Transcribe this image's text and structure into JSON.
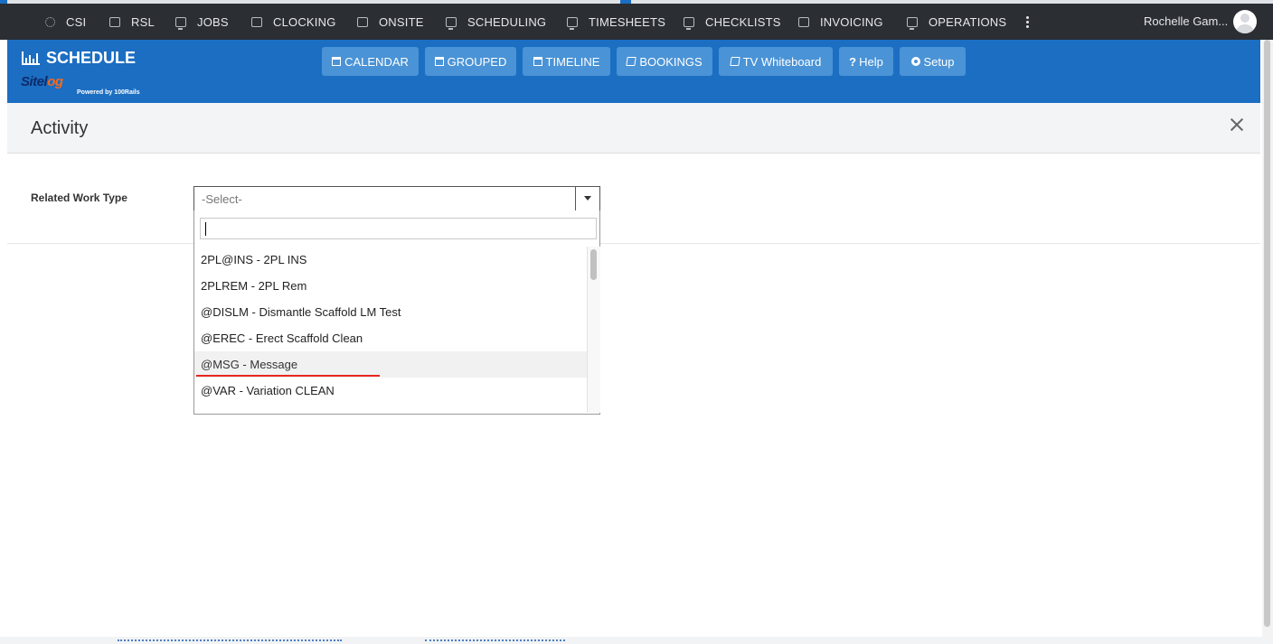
{
  "topnav": {
    "items": [
      {
        "label": "CSI",
        "icon": "gear-icon"
      },
      {
        "label": "RSL",
        "icon": "screen-icon"
      },
      {
        "label": "JOBS",
        "icon": "monitor-icon"
      },
      {
        "label": "CLOCKING",
        "icon": "screen-icon"
      },
      {
        "label": "ONSITE",
        "icon": "screen-icon"
      },
      {
        "label": "SCHEDULING",
        "icon": "monitor-icon"
      },
      {
        "label": "TIMESHEETS",
        "icon": "monitor-icon"
      },
      {
        "label": "CHECKLISTS",
        "icon": "monitor-icon"
      },
      {
        "label": "INVOICING",
        "icon": "screen-icon"
      },
      {
        "label": "OPERATIONS",
        "icon": "monitor-icon"
      }
    ],
    "more_icon": "kebab-icon",
    "user_name": "Rochelle Gam...",
    "avatar_icon": "user-avatar-icon"
  },
  "schedule_header": {
    "title": "SCHEDULE",
    "title_icon": "bar-chart-icon",
    "logo_text_a": "Sitel",
    "logo_text_b": "o",
    "logo_text_c": "g",
    "powered_by": "Powered by 100Rails",
    "buttons": [
      {
        "label": "CALENDAR",
        "icon": "calendar-icon"
      },
      {
        "label": "GROUPED",
        "icon": "calendar-icon"
      },
      {
        "label": "TIMELINE",
        "icon": "calendar-icon"
      },
      {
        "label": "BOOKINGS",
        "icon": "book-icon"
      },
      {
        "label": "TV Whiteboard",
        "icon": "book-icon"
      },
      {
        "label": "Help",
        "icon": "question-icon"
      },
      {
        "label": "Setup",
        "icon": "cog-icon"
      }
    ]
  },
  "modal": {
    "title": "Activity",
    "close_icon": "close-icon",
    "field_label": "Related Work Type",
    "select": {
      "value": "-Select-",
      "search_value": "",
      "options": [
        "2PL@INS - 2PL INS",
        "2PLREM - 2PL Rem",
        "@DISLM - Dismantle Scaffold LM Test",
        "@EREC - Erect Scaffold Clean",
        "@MSG - Message",
        "@VAR - Variation CLEAN"
      ],
      "highlighted_option": "@MSG - Message"
    }
  },
  "colors": {
    "topnav_bg": "#2b2e33",
    "header_blue": "#1b6ec2",
    "header_button": "#4a93d6",
    "underline_red": "#e8271f"
  }
}
